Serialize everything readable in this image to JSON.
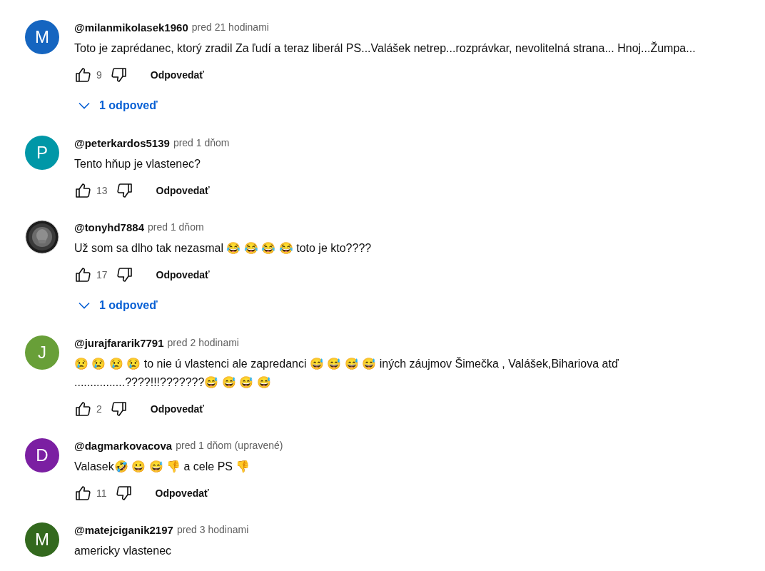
{
  "comments": [
    {
      "avatar": {
        "kind": "letter",
        "letter": "M",
        "color": "#1565c0"
      },
      "author": "@milanmikolasek1960",
      "time": "pred 21 hodinami",
      "text": "Toto je zaprédanec, ktorý zradil Za ľudí a teraz liberál PS...Valášek netrep...rozprávkar, nevolitelná strana... Hnoj...Žumpa...",
      "likes": "9",
      "reply_label": "Odpovedať",
      "replies": "1 odpoveď"
    },
    {
      "avatar": {
        "kind": "letter",
        "letter": "P",
        "color": "#0097a7"
      },
      "author": "@peterkardos5139",
      "time": "pred 1 dňom",
      "text": "Tento hňup je vlastenec?",
      "likes": "13",
      "reply_label": "Odpovedať"
    },
    {
      "author": "@tonyhd7884",
      "time": "pred 1 dňom",
      "text": "Už som sa dlho tak nezasmal 😂 😂 😂 😂  toto je kto????",
      "likes": "17",
      "reply_label": "Odpovedať",
      "replies": "1 odpoveď"
    },
    {
      "avatar": {
        "kind": "letter",
        "letter": "J",
        "color": "#689f38"
      },
      "author": "@jurajfararik7791",
      "time": "pred 2 hodinami",
      "text": "😢 😢 😢 😢 to nie ú vlastenci ale zapredanci 😅 😅 😅 😅 iných záujmov Šimečka , Valášek,Bihariova atď ................????!!!???????😅 😅 😅 😅",
      "likes": "2",
      "reply_label": "Odpovedať"
    },
    {
      "avatar": {
        "kind": "letter",
        "letter": "D",
        "color": "#7b1fa2"
      },
      "author": "@dagmarkovacova",
      "time": "pred 1 dňom (upravené)",
      "text": "Valasek🤣 😀 😅 👎 a cele PS 👎",
      "likes": "11",
      "reply_label": "Odpovedať"
    },
    {
      "avatar": {
        "kind": "letter",
        "letter": "M",
        "color": "#33691e"
      },
      "author": "@matejciganik2197",
      "time": "pred 3 hodinami",
      "text": "americky vlastenec"
    }
  ]
}
